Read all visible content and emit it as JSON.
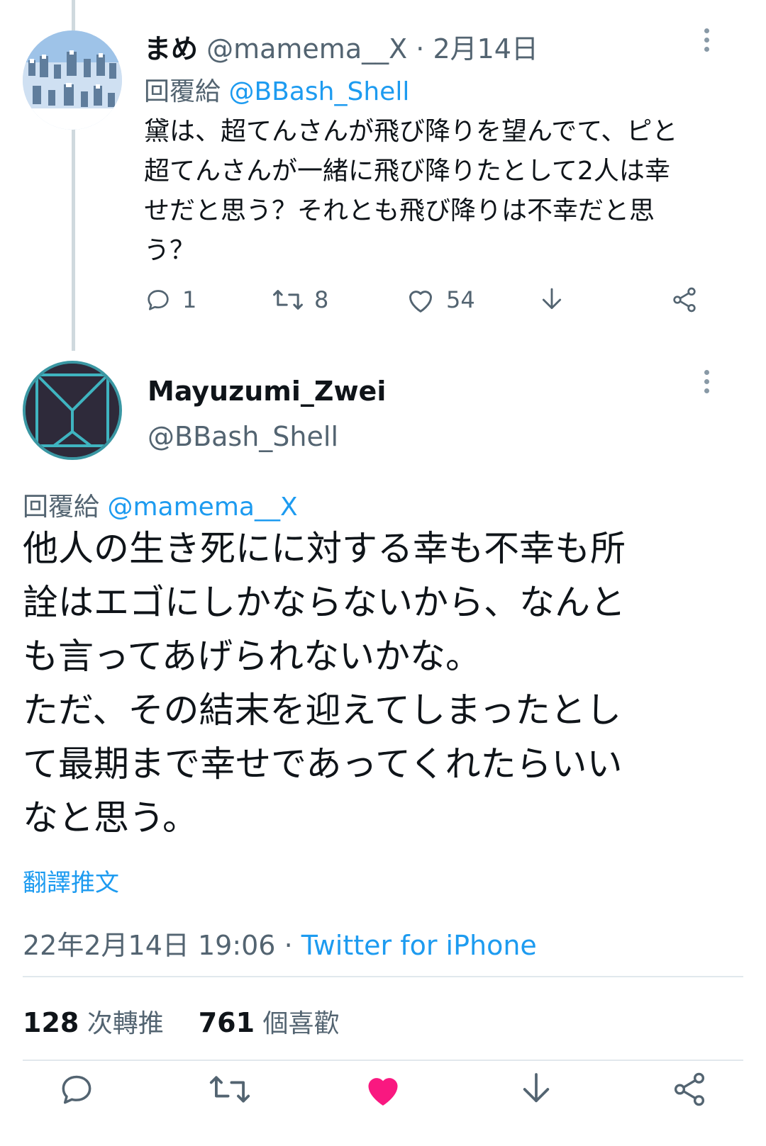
{
  "parent_tweet": {
    "display_name": "まめ",
    "handle": "@mamema__X",
    "separator": "·",
    "date": "2月14日",
    "reply_prefix": "回覆給",
    "reply_handle": "@BBash_Shell",
    "text": "黛は、超てんさんが飛び降りを望んでて、ピと\n超てんさんが一緒に飛び降りたとして2人は幸\nせだと思う？それとも飛び降りは不幸だと思\nう？",
    "reply_count": "1",
    "retweet_count": "8",
    "like_count": "54"
  },
  "main_tweet": {
    "display_name": "Mayuzumi_Zwei",
    "handle": "@BBash_Shell",
    "reply_prefix": "回覆給",
    "reply_handle": "@mamema__X",
    "text": "他人の生き死にに対する幸も不幸も所\n詮はエゴにしかならないから、なんと\nも言ってあげられないかな。\nただ、その結末を迎えてしまったとし\nて最期まで幸せであってくれたらいい\nなと思う。",
    "translate_label": "翻譯推文",
    "timestamp": "22年2月14日 19:06",
    "separator": "·",
    "client": "Twitter for iPhone",
    "retweets_count": "128",
    "retweets_label": "次轉推",
    "likes_count": "761",
    "likes_label": "個喜歡",
    "liked": true
  },
  "colors": {
    "link": "#1d9bf0",
    "secondary_text": "#536471",
    "like_active": "#f91880",
    "avatar2_accent": "#3a97a3"
  }
}
